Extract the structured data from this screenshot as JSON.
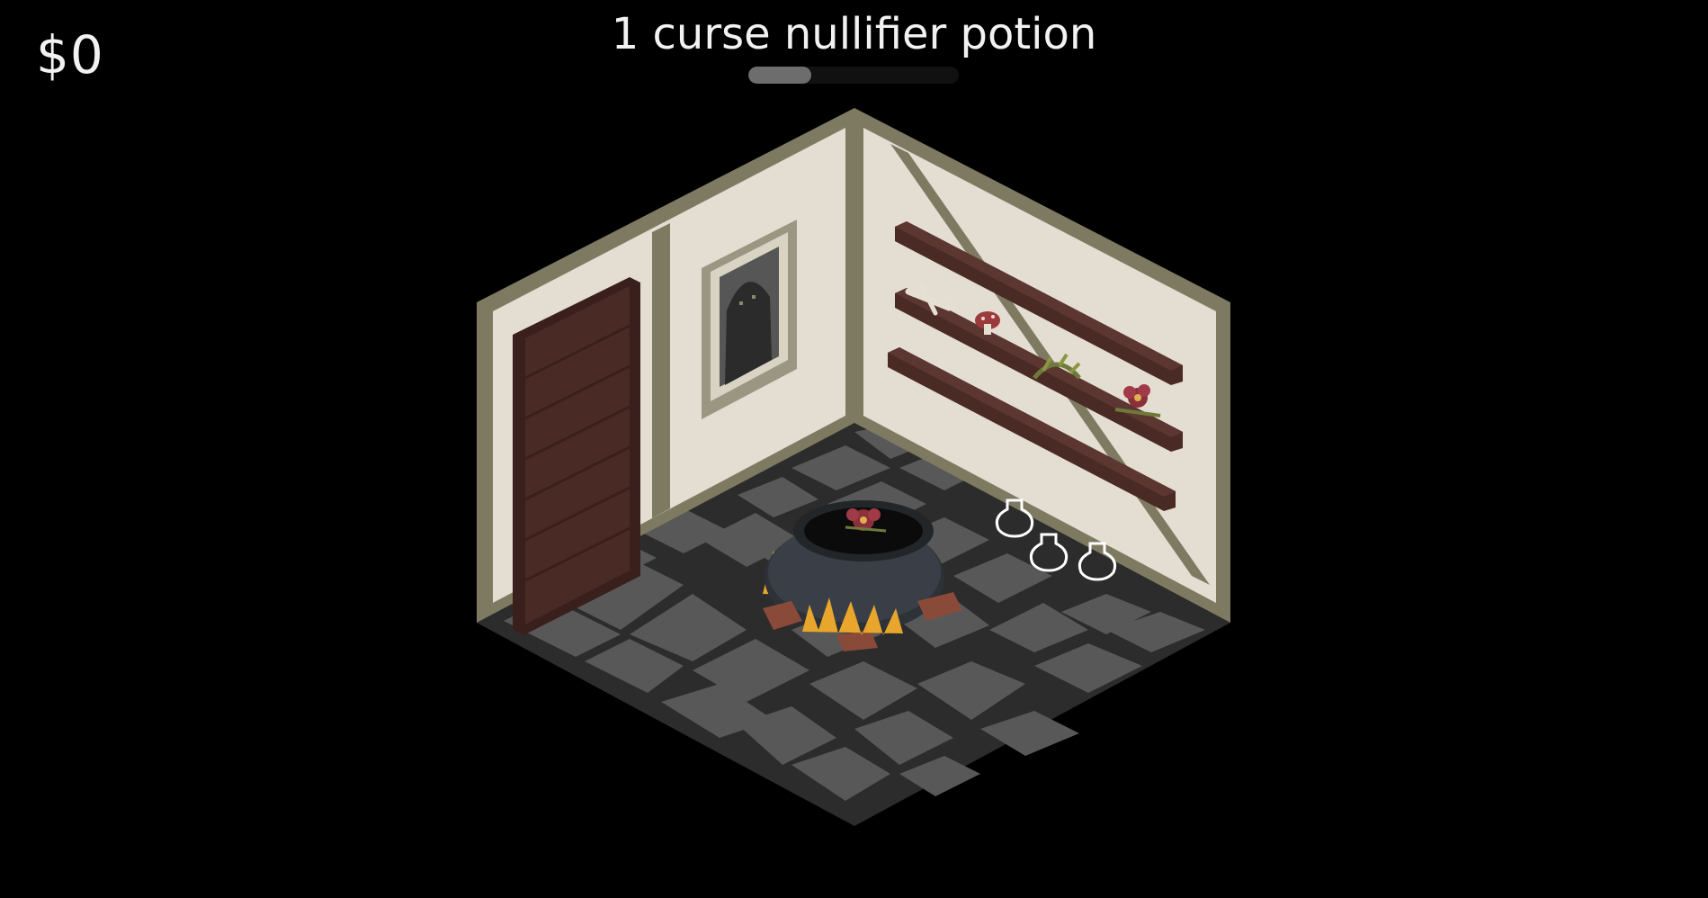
{
  "hud": {
    "money": "$0",
    "order_title": "1 curse nullifier potion",
    "order_progress": 0.3
  },
  "scene": {
    "cauldron_ingredient": "red-flower-icon",
    "empty_potion_slots": 3,
    "shelf_items": [
      "bone-icon",
      "red-mushroom-icon",
      "green-herb-icon",
      "red-flower-icon"
    ]
  },
  "colors": {
    "background": "#000000",
    "wall": "#e4ddd2",
    "wall_trim": "#7e7a62",
    "floor": "#5a5a5a",
    "floor_grout": "#2c2c2c",
    "wood": "#4a2a24",
    "fire": "#e8a72c",
    "text": "#f2f2f2"
  }
}
